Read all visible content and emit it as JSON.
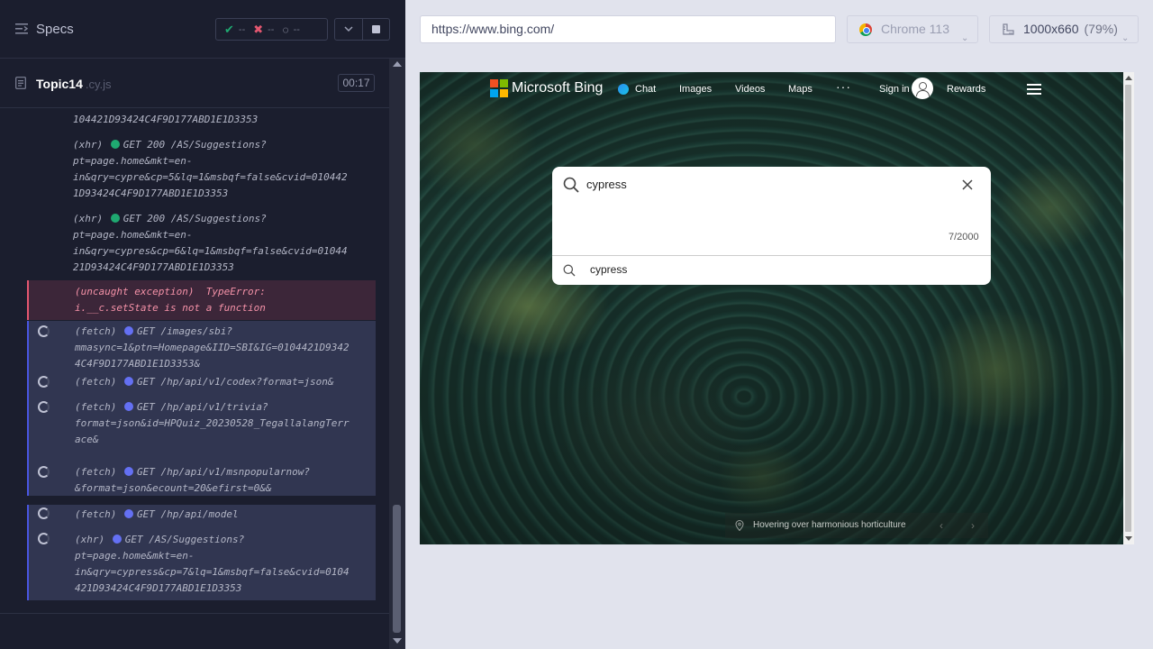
{
  "specs": {
    "title": "Specs",
    "passed": "--",
    "failed": "--",
    "pending": "--"
  },
  "file": {
    "name": "Topic14",
    "ext": ".cy.js",
    "duration": "00:17"
  },
  "log": {
    "top_fragment": "104421D93424C4F9D177ABD1E1D3353",
    "entries": [
      {
        "type": "(xhr)",
        "status_dot": "green",
        "method_line": "GET 200 /AS/Suggestions?",
        "lines": [
          "pt=page.home&mkt=en-",
          "in&qry=cypre&cp=5&lq=1&msbqf=false&cvid=010442",
          "1D93424C4F9D177ABD1E1D3353"
        ]
      },
      {
        "type": "(xhr)",
        "status_dot": "green",
        "method_line": "GET 200 /AS/Suggestions?",
        "lines": [
          "pt=page.home&mkt=en-",
          "in&qry=cypres&cp=6&lq=1&msbqf=false&cvid=01044",
          "21D93424C4F9D177ABD1E1D3353"
        ]
      },
      {
        "type": "(uncaught exception)",
        "error_name": "TypeError:",
        "lines": [
          "i.__c.setState is not a function"
        ]
      },
      {
        "type": "(fetch)",
        "status_dot": "blue",
        "method_line": "GET /images/sbi?",
        "lines": [
          "mmasync=1&ptn=Homepage&IID=SBI&IG=0104421D9342",
          "4C4F9D177ABD1E1D3353&"
        ]
      },
      {
        "type": "(fetch)",
        "status_dot": "blue",
        "method_line": "GET /hp/api/v1/codex?format=json&",
        "lines": []
      },
      {
        "type": "(fetch)",
        "status_dot": "blue",
        "method_line": "GET /hp/api/v1/trivia?",
        "lines": [
          "format=json&id=HPQuiz_20230528_TegallalangTerr",
          "ace&"
        ]
      },
      {
        "type": "(fetch)",
        "status_dot": "blue",
        "method_line": "GET /hp/api/v1/msnpopularnow?",
        "lines": [
          "&format=json&ecount=20&efirst=0&&"
        ]
      },
      {
        "type": "(fetch)",
        "status_dot": "blue",
        "method_line": "GET /hp/api/model",
        "lines": []
      },
      {
        "type": "(xhr)",
        "status_dot": "blue",
        "method_line": "GET /AS/Suggestions?",
        "lines": [
          "pt=page.home&mkt=en-",
          "in&qry=cypress&cp=7&lq=1&msbqf=false&cvid=0104",
          "421D93424C4F9D177ABD1E1D3353"
        ]
      }
    ]
  },
  "browser_bar": {
    "url": "https://www.bing.com/",
    "browser": "Chrome 113",
    "viewport": "1000x660",
    "zoom": "(79%)"
  },
  "bing": {
    "brand": "Microsoft Bing",
    "nav": [
      "Chat",
      "Images",
      "Videos",
      "Maps"
    ],
    "more": "···",
    "sign_in": "Sign in",
    "rewards": "Rewards",
    "search_value": "cypress",
    "char_count": "7/2000",
    "suggestion": "cypress",
    "caption": "Hovering over harmonious horticulture",
    "logo_colors": [
      "#f25022",
      "#7fba00",
      "#00a4ef",
      "#ffb900"
    ]
  },
  "colors": {
    "pass": "#1fa971",
    "fail": "#e45770",
    "pending_accent": "#4956e3"
  }
}
